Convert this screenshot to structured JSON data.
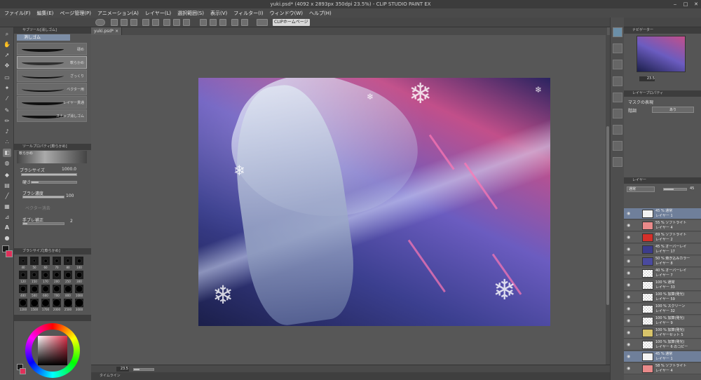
{
  "window": {
    "title": "yuki.psd* (4092 x 2893px 350dpi 23.5%) - CLIP STUDIO PAINT EX"
  },
  "menu": [
    "ファイル(F)",
    "編集(E)",
    "ページ管理(P)",
    "アニメーション(A)",
    "レイヤー(L)",
    "選択範囲(S)",
    "表示(V)",
    "フィルター(I)",
    "ウィンドウ(W)",
    "ヘルプ(H)"
  ],
  "command_bar": {
    "clip_home_label": "CLIPホームページ"
  },
  "document": {
    "tab_name": "yuki.psd*"
  },
  "subtool_panel": {
    "header": "サブツール[消しゴム]",
    "group_tab": "消しゴム",
    "brushes": [
      {
        "name": "硬め",
        "selected": false
      },
      {
        "name": "軟らかめ",
        "selected": true
      },
      {
        "name": "ざっくり",
        "selected": false
      },
      {
        "name": "ベクター用",
        "selected": false
      },
      {
        "name": "レイヤー貫通",
        "selected": false
      },
      {
        "name": "スナップ消しゴム",
        "selected": false
      }
    ]
  },
  "tool_property": {
    "header": "ツールプロパティ[軟らかめ]",
    "tool_name": "軟らかめ",
    "brush_size_label": "ブラシサイズ",
    "brush_size_value": "1000.0",
    "hardness_label": "硬さ",
    "density_label": "ブラシ濃度",
    "density_value": "100",
    "vector_erase_label": "ベクター消去",
    "stabilization_label": "手ブレ補正",
    "stabilization_value": "2"
  },
  "brush_size_panel": {
    "header": "ブラシサイズ[軟らかめ]",
    "sizes": [
      "40",
      "50",
      "60",
      "70",
      "80",
      "100",
      "120",
      "150",
      "170",
      "200",
      "250",
      "300",
      "400",
      "500",
      "600",
      "700",
      "800",
      "1000",
      "1200",
      "1500",
      "1700",
      "2000",
      "2500",
      "3000"
    ]
  },
  "status": {
    "zoom": "23.5"
  },
  "timeline": {
    "label": "タイムライン"
  },
  "navigator": {
    "header": "ナビゲーター",
    "zoom": "23.5"
  },
  "layer_property": {
    "header": "レイヤープロパティ",
    "mask_label": "マスクの表現",
    "tone_label": "階調",
    "tone_value": "あり"
  },
  "layer_panel": {
    "header": "レイヤー",
    "blend_mode": "通常",
    "opacity": "45",
    "layers": [
      {
        "line1": "45 % 通常",
        "line2": "レイヤー 1",
        "selected": true,
        "thumb": "#f2f2f2"
      },
      {
        "line1": "55 % ソフトライト",
        "line2": "レイヤー 4",
        "selected": false,
        "thumb": "#e98a8a"
      },
      {
        "line1": "69 % ソフトライト",
        "line2": "レイヤー 2",
        "selected": false,
        "thumb": "#d4302a"
      },
      {
        "line1": "45 % オーバーレイ",
        "line2": "レイヤー 17",
        "selected": false,
        "thumb": "#3c3c8c"
      },
      {
        "line1": "50 % 焼き込みカラー",
        "line2": "レイヤー 8",
        "selected": false,
        "thumb": "#4a4a9e"
      },
      {
        "line1": "40 % オーバーレイ",
        "line2": "レイヤー 7",
        "selected": false,
        "thumb": ""
      },
      {
        "line1": "100 % 通常",
        "line2": "レイヤー 33",
        "selected": false,
        "thumb": ""
      },
      {
        "line1": "100 % 加算(発光)",
        "line2": "レイヤー 59",
        "selected": false,
        "thumb": ""
      },
      {
        "line1": "100 % スクリーン",
        "line2": "レイヤー 32",
        "selected": false,
        "thumb": ""
      },
      {
        "line1": "100 % 加算(発光)",
        "line2": "レイヤー 9",
        "selected": false,
        "thumb": ""
      },
      {
        "line1": "100 % 加算(発光)",
        "line2": "レイヤーセット 5",
        "selected": false,
        "thumb": "folder"
      },
      {
        "line1": "100 % 加算(発光)",
        "line2": "レイヤー 6 のコピー",
        "selected": false,
        "thumb": ""
      },
      {
        "line1": "45 % 通常",
        "line2": "レイヤー 1",
        "selected": true,
        "thumb": "#f2f2f2"
      },
      {
        "line1": "58 % ソフトライト",
        "line2": "レイヤー 4",
        "selected": false,
        "thumb": "#e98a8a"
      }
    ]
  },
  "colors": {
    "main": "#1a1a1a",
    "sub": "#e0305a",
    "accent": "#8fb0d8"
  }
}
